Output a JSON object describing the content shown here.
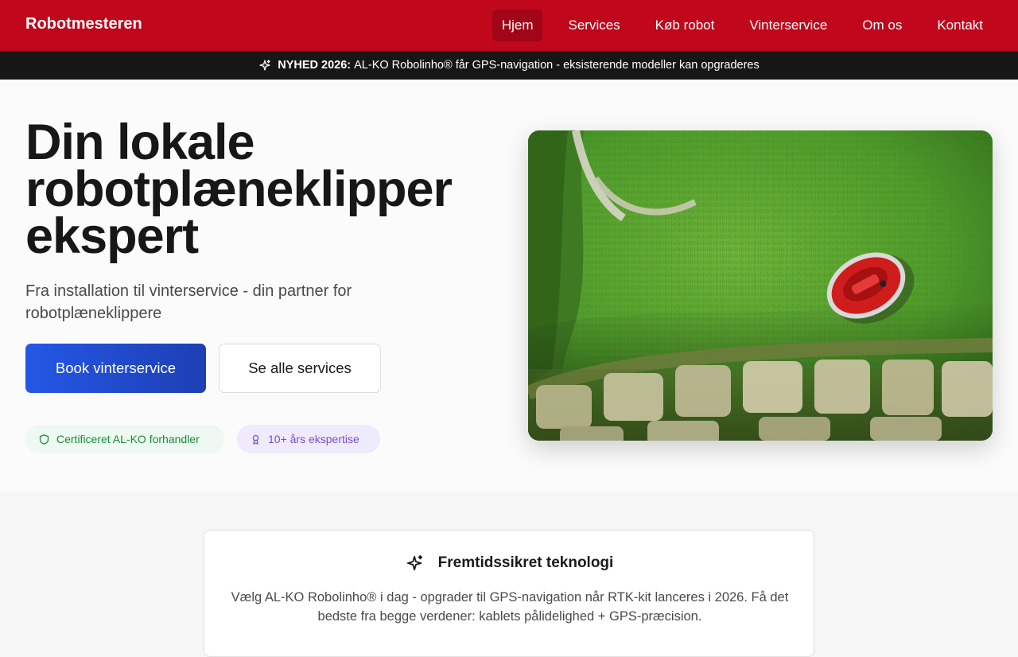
{
  "header": {
    "brand": "Robotmesteren",
    "nav": [
      {
        "label": "Hjem"
      },
      {
        "label": "Services"
      },
      {
        "label": "Køb robot"
      },
      {
        "label": "Vinterservice"
      },
      {
        "label": "Om os"
      },
      {
        "label": "Kontakt"
      }
    ],
    "active": "Hjem"
  },
  "announcement": {
    "highlight": "NYHED 2026:",
    "text": "AL-KO Robolinho® får GPS-navigation - eksisterende modeller kan opgraderes",
    "icon": "sparkles-icon"
  },
  "hero": {
    "title": "Din lokale robotplæneklipper ekspert",
    "subtitle": "Fra installation til vinterservice - din partner for robotplæneklippere",
    "primary_button": "Book vinterservice",
    "secondary_button": "Se alle services",
    "badges": [
      {
        "label": "Certificeret AL-KO forhandler",
        "icon": "shield-icon"
      },
      {
        "label": "10+ års ekspertise",
        "icon": "award-icon"
      }
    ],
    "image": "aerial-lawn-robot-mower-photo"
  },
  "feature": {
    "icon": "sparkles-icon",
    "title": "Fremtidssikret teknologi",
    "text": "Vælg AL-KO Robolinho® i dag - opgrader til GPS-navigation når RTK-kit lanceres i 2026. Få det bedste fra begge verdener: kablets pålidelighed + GPS-præcision."
  },
  "colors": {
    "brand_red": "#c0071c",
    "announce_bg": "#161616",
    "primary_blue": "#2457e6",
    "badge_green": "#188a3c",
    "badge_purple": "#7a4fc8"
  }
}
